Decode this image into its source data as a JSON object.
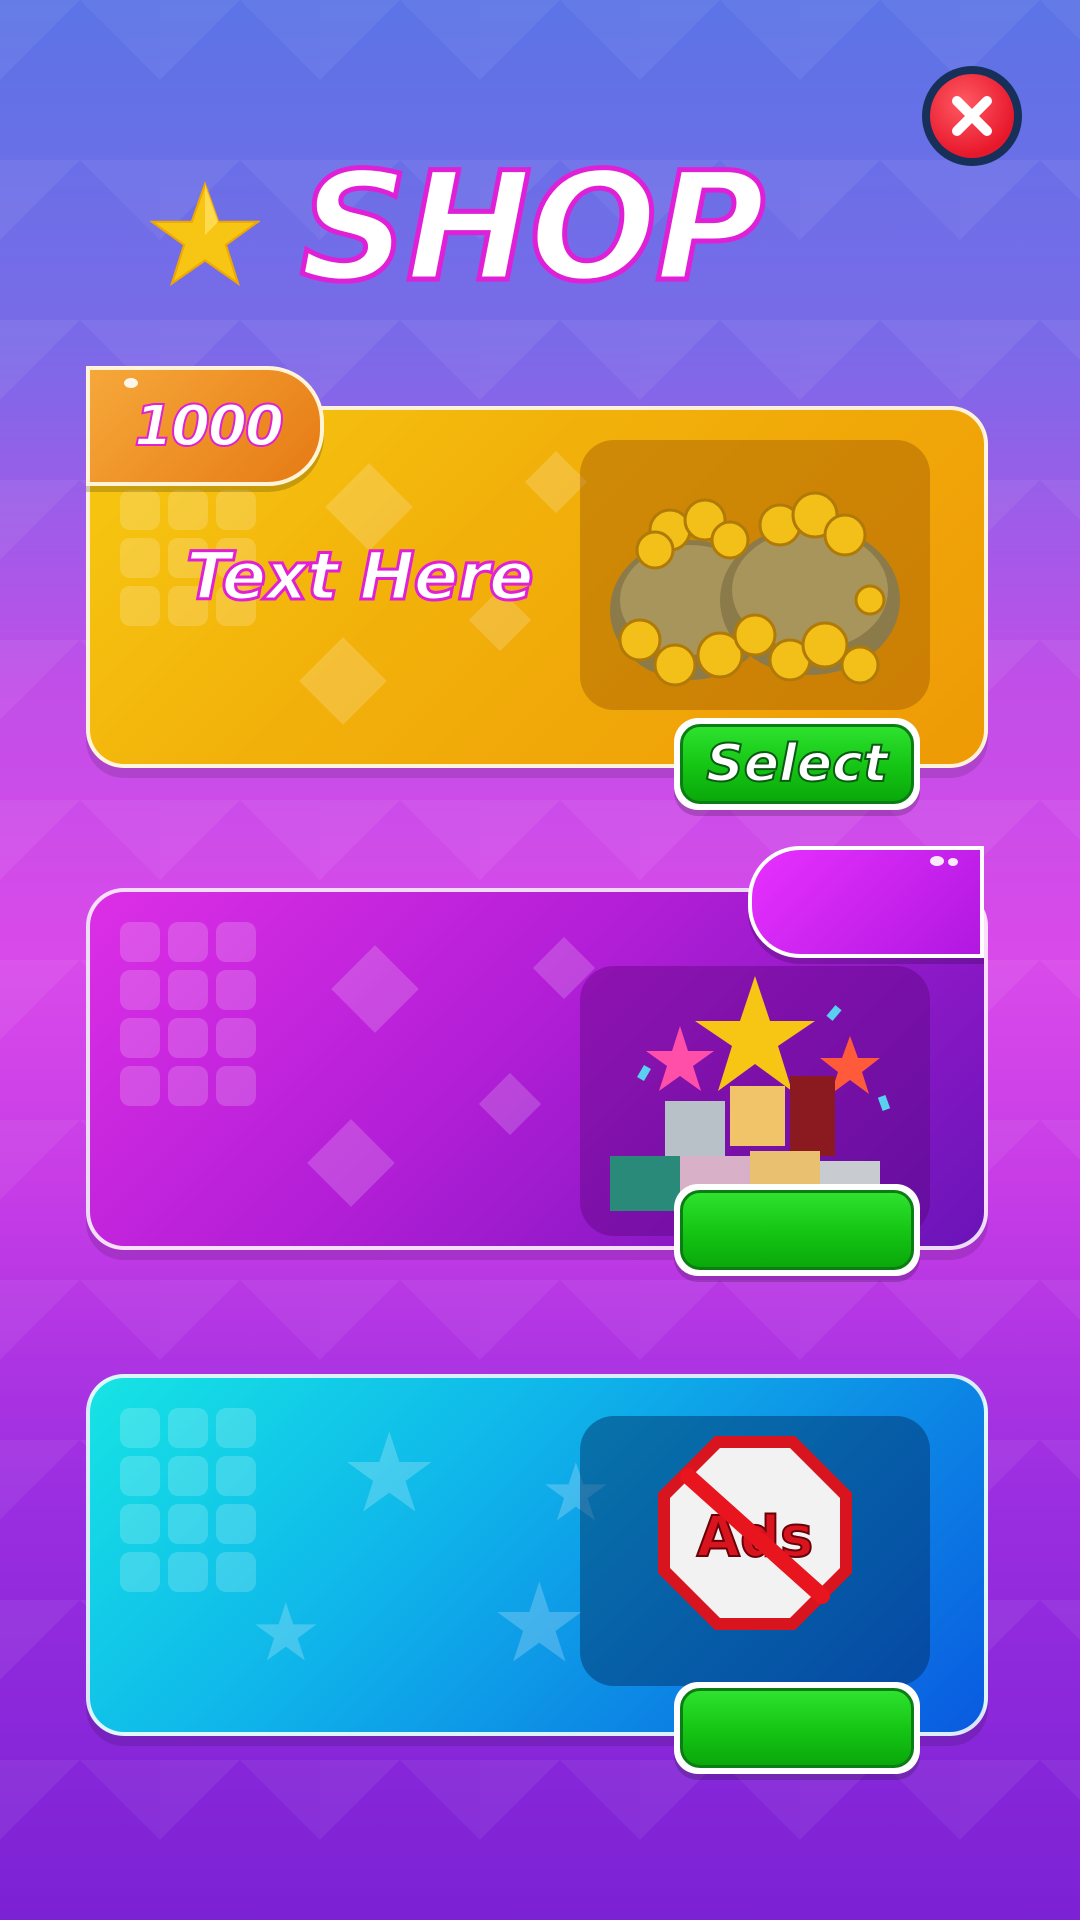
{
  "header": {
    "title": "SHOP",
    "close_icon": "close-icon",
    "star_icon": "star-icon"
  },
  "cards": [
    {
      "tag_label": "1000",
      "text": "Text Here",
      "image": "coin-bags-image",
      "button_label": "Select",
      "color": "#f2b10a"
    },
    {
      "tag_label": "",
      "text": "",
      "image": "gift-boxes-image",
      "button_label": "",
      "color": "#b21ed6"
    },
    {
      "tag_label": "",
      "text": "",
      "image": "no-ads-image",
      "image_text": "Ads",
      "button_label": "",
      "color": "#0fb4ea"
    }
  ],
  "colors": {
    "title_outline": "#e020d6",
    "button_green": "#14c414",
    "close_red": "#e8182c"
  }
}
